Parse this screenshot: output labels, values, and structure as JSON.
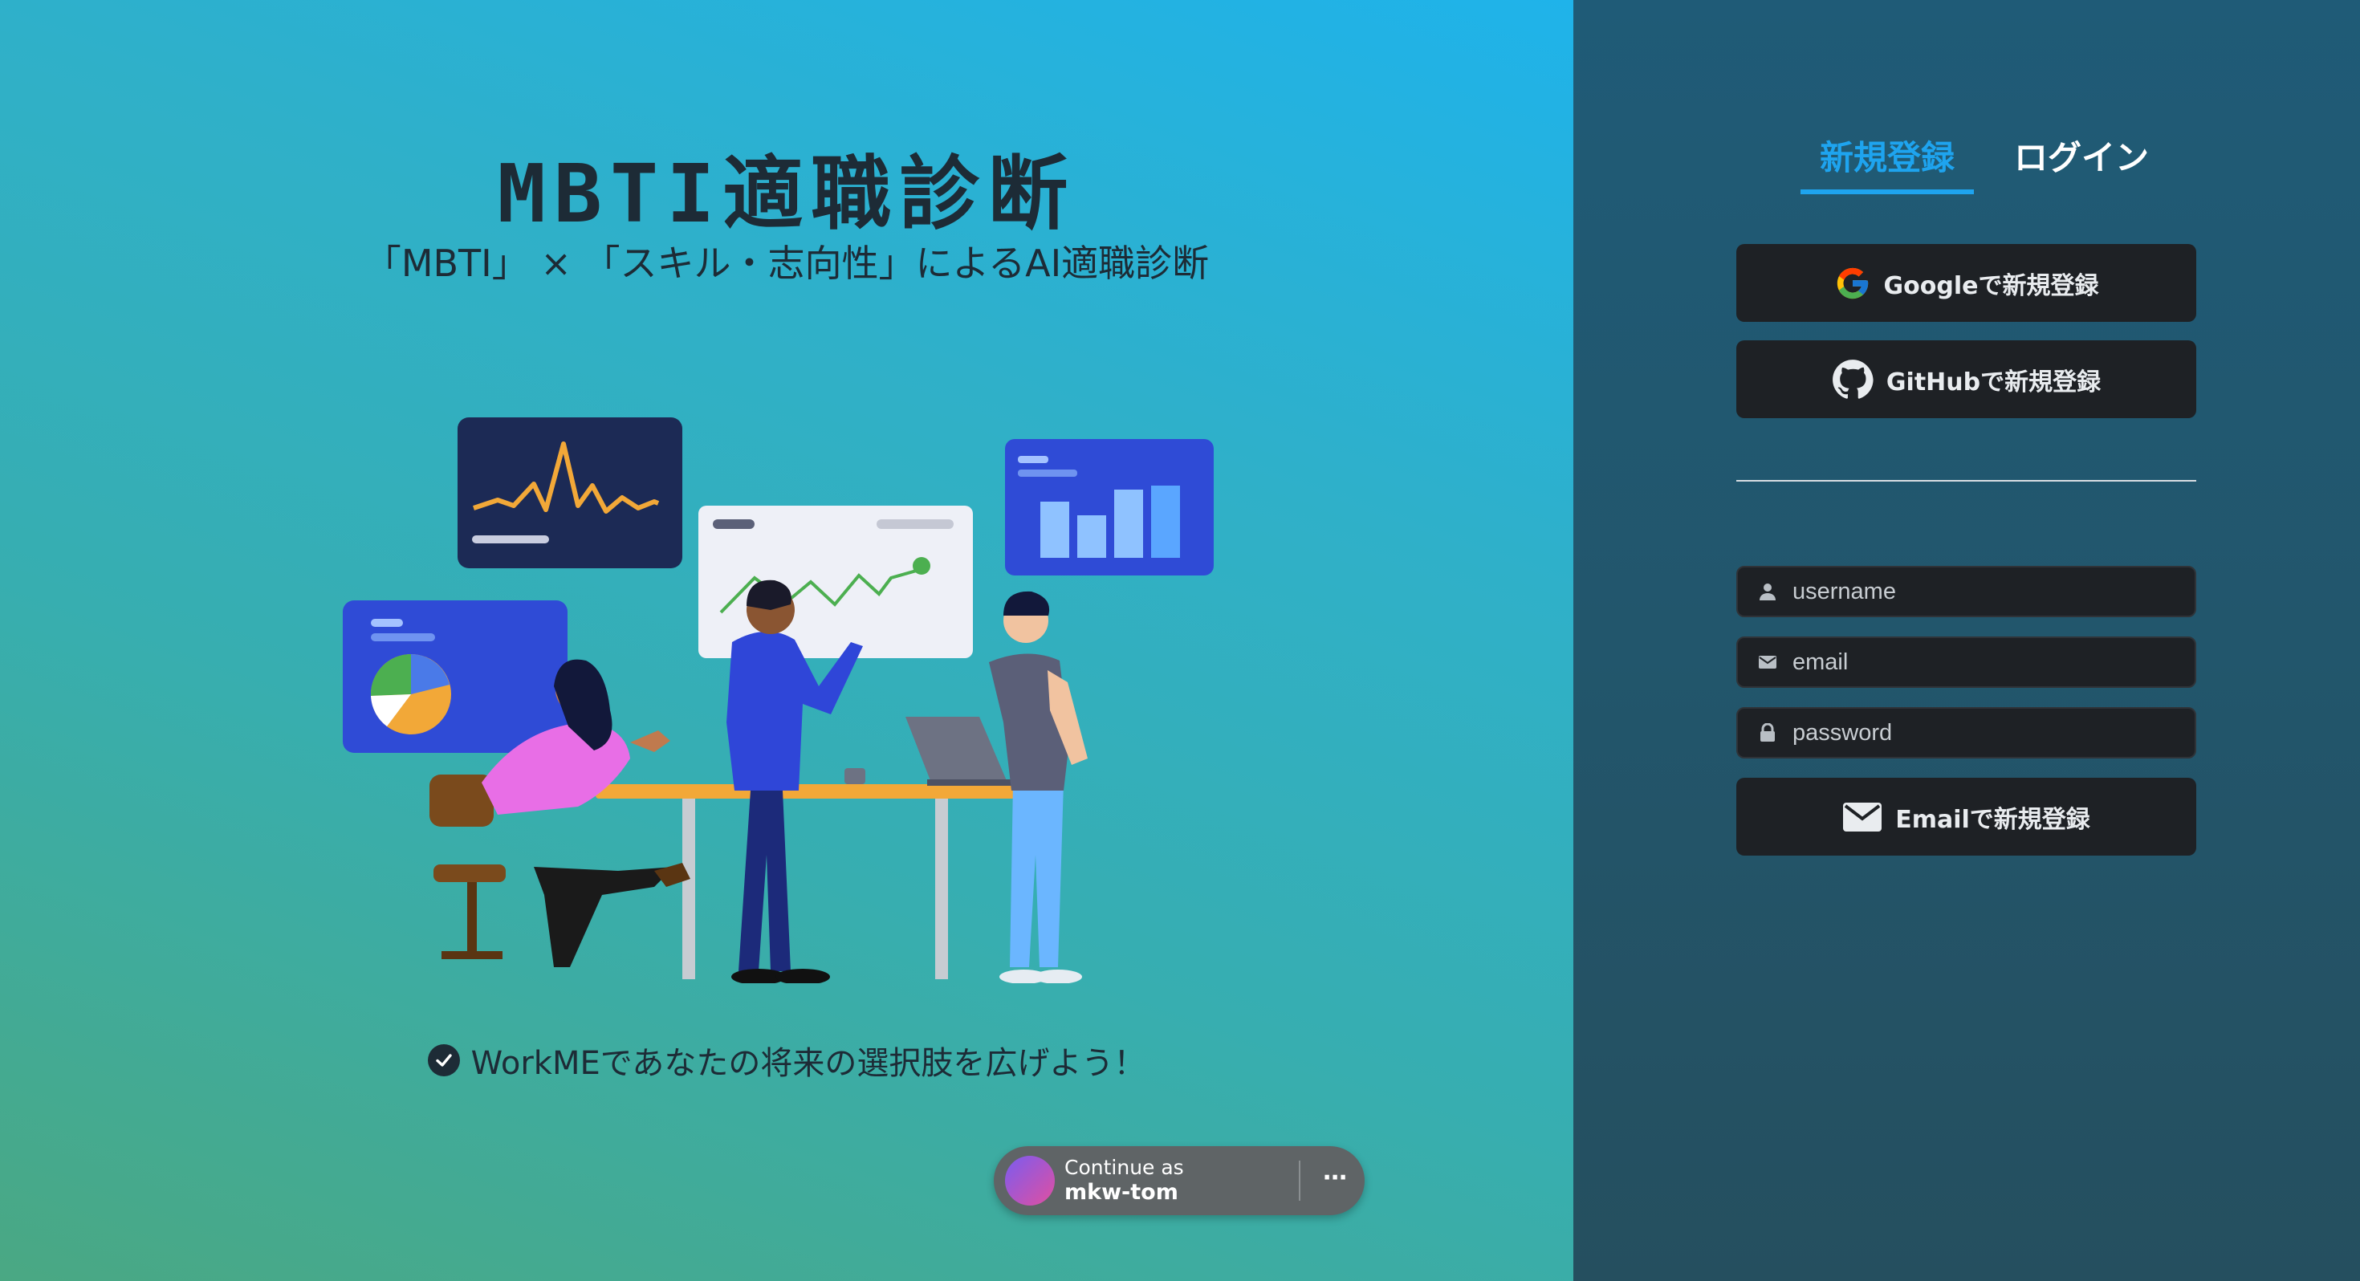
{
  "hero": {
    "title": "MBTI適職診断",
    "subtitle": "「MBTI」 × 「スキル・志向性」によるAI適職診断",
    "tagline": "WorkMEであなたの将来の選択肢を広げよう！"
  },
  "auth": {
    "tabs": [
      {
        "label": "新規登録",
        "active": true
      },
      {
        "label": "ログイン",
        "active": false
      }
    ],
    "google_label": "Googleで新規登録",
    "github_label": "GitHubで新規登録",
    "username_placeholder": "username",
    "email_placeholder": "email",
    "password_placeholder": "password",
    "email_submit_label": "Emailで新規登録"
  },
  "one_tap": {
    "line1": "Continue as",
    "account": "mkw-tom",
    "more": "⋯"
  },
  "colors": {
    "accent": "#1ea4ef",
    "button_bg": "#1e2125",
    "panel_bg": "#22566c"
  },
  "icons": [
    "google-icon",
    "github-icon",
    "user-icon",
    "mail-icon",
    "lock-icon",
    "envelope-icon",
    "check-circle-icon"
  ]
}
